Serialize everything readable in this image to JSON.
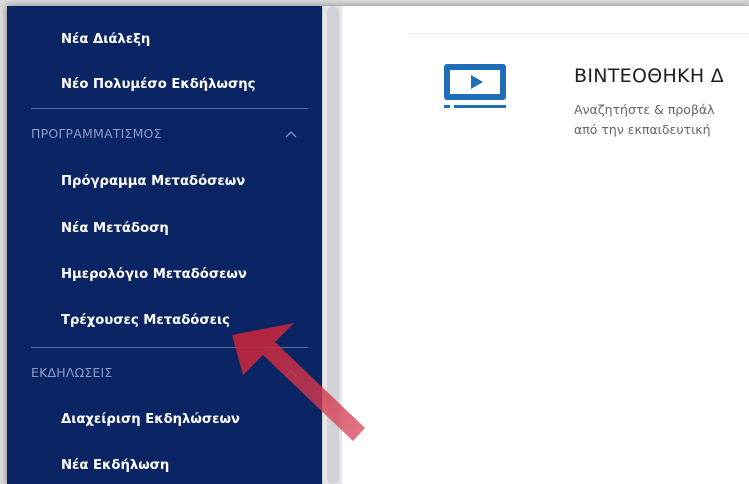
{
  "sidebar": {
    "items_top": [
      {
        "label": "Νέα Διάλεξη"
      },
      {
        "label": "Νέο Πολυμέσο Εκδήλωσης"
      }
    ],
    "sections": [
      {
        "header": "ΠΡΟΓΡΑΜΜΑΤΙΣΜΟΣ",
        "items": [
          {
            "label": "Πρόγραμμα Μεταδόσεων"
          },
          {
            "label": "Νέα Μετάδοση"
          },
          {
            "label": "Ημερολόγιο Μεταδόσεων"
          },
          {
            "label": "Τρέχουσες Μεταδόσεις"
          }
        ]
      },
      {
        "header": "ΕΚΔΗΛΩΣΕΙΣ",
        "items": [
          {
            "label": "Διαχείριση Εκδηλώσεων"
          },
          {
            "label": "Νέα Εκδήλωση"
          }
        ]
      }
    ]
  },
  "main": {
    "card": {
      "title": "ΒΙΝΤΕΟΘΗΚΗ Δ",
      "desc_line1": "Αναζητήστε & προβάλ",
      "desc_line2": "από την εκπαιδευτική",
      "icon": "video-play-icon"
    }
  },
  "colors": {
    "sidebar_bg": "#0b2464",
    "section_header": "#8c9cc6",
    "accent_blue": "#1f6fb8",
    "arrow": "#c7283b"
  }
}
